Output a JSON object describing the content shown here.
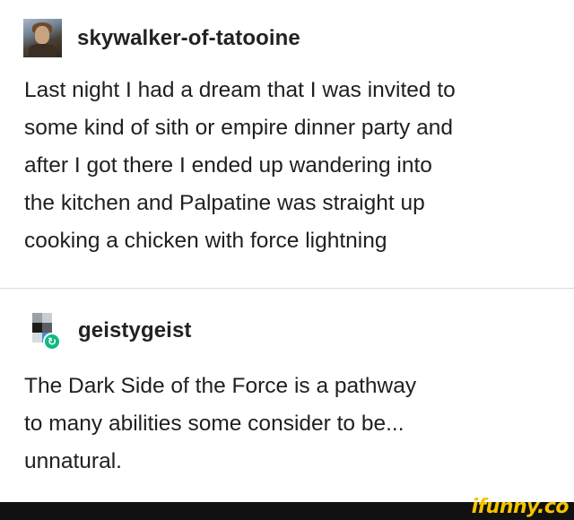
{
  "posts": [
    {
      "username": "skywalker-of-tatooine",
      "avatar_icon": "user-portrait-avatar",
      "lines": [
        "Last night I had a dream that I was invited to",
        "some kind of sith or empire dinner party and",
        "after I got there I ended up wandering into",
        "the kitchen and Palpatine was straight up",
        "cooking a chicken with force lightning"
      ]
    },
    {
      "username": "geistygeist",
      "avatar_icon": "pixel-avatar",
      "badge_icon": "reblog-icon",
      "badge_color": "#10b981",
      "lines": [
        "The Dark Side of the Force is a pathway",
        "to many abilities some consider to be...",
        "unnatural."
      ]
    }
  ],
  "watermark": {
    "text": "ifunny.co",
    "color": "#f5c400"
  }
}
